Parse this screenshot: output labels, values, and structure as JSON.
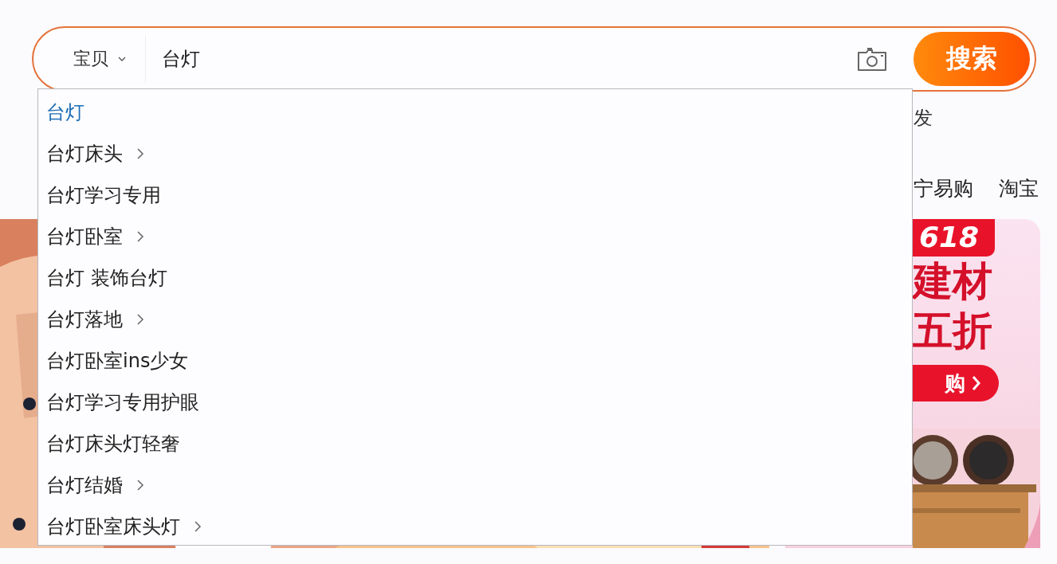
{
  "search": {
    "category": "宝贝",
    "query": "台灯",
    "button": "搜索"
  },
  "suggestions": [
    {
      "text": "台灯",
      "selected": true,
      "has_more": false
    },
    {
      "text": "台灯床头",
      "selected": false,
      "has_more": true
    },
    {
      "text": "台灯学习专用",
      "selected": false,
      "has_more": false
    },
    {
      "text": "台灯卧室",
      "selected": false,
      "has_more": true
    },
    {
      "text": "台灯 装饰台灯",
      "selected": false,
      "has_more": false
    },
    {
      "text": "台灯落地",
      "selected": false,
      "has_more": true
    },
    {
      "text": "台灯卧室ins少女",
      "selected": false,
      "has_more": false
    },
    {
      "text": "台灯学习专用护眼",
      "selected": false,
      "has_more": false
    },
    {
      "text": "台灯床头灯轻奢",
      "selected": false,
      "has_more": false
    },
    {
      "text": "台灯结婚",
      "selected": false,
      "has_more": true
    },
    {
      "text": "台灯卧室床头灯",
      "selected": false,
      "has_more": true
    }
  ],
  "hot_words": [
    "发"
  ],
  "nav_links": [
    "宁易购",
    "淘宝"
  ],
  "promo": {
    "badge": "618",
    "headline": [
      "建材",
      "五折"
    ],
    "button": "购"
  }
}
